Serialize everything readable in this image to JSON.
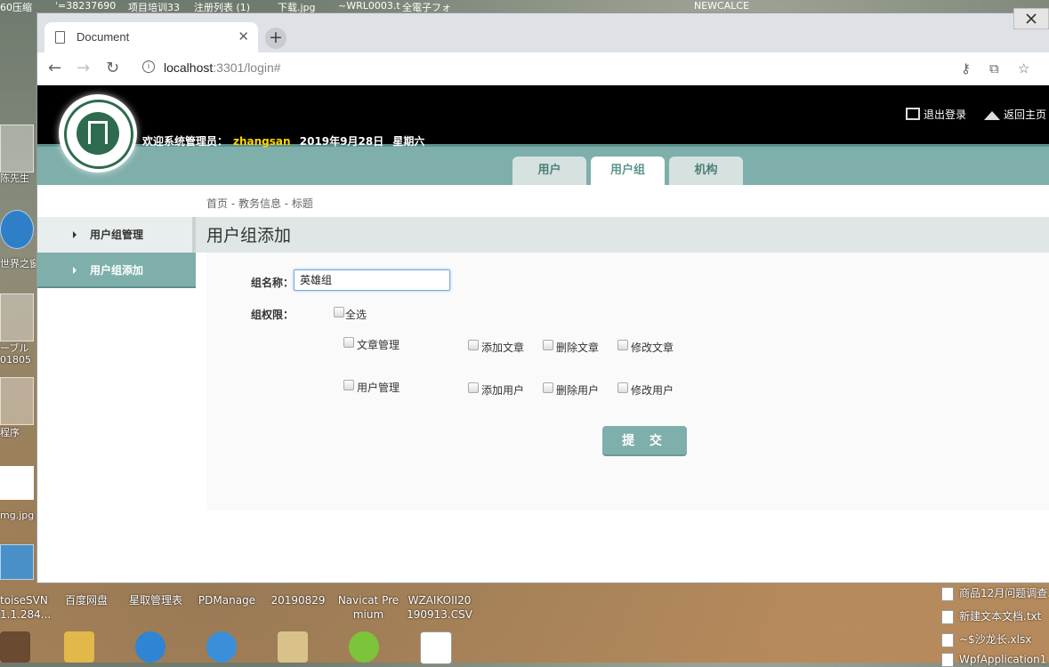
{
  "desktop": {
    "top_strip": [
      "60压缩",
      "ˈ=38237690",
      "项目培训33",
      "注册列表 (1)",
      "下载.jpg",
      "~WRL0003.t",
      "全電子フォ",
      "NEWCALCE"
    ],
    "left_labels": [
      "陈先生",
      "世界之窗",
      "ーブル",
      "01805",
      "程序",
      "mg.jpg"
    ],
    "bottom_labels": [
      "toiseSVN\n1.1.284...",
      "百度网盘",
      "星取管理表",
      "PDManage",
      "20190829",
      "Navicat Pre\nmium",
      "WZAIKOII20\n190913.CSV"
    ],
    "right_files": [
      "商品12月问题调查.",
      "新建文本文档.txt",
      "~$沙龙长.xlsx",
      "WpfApplication1"
    ]
  },
  "browser": {
    "tab_title": "Document",
    "url_host": "localhost",
    "url_rest": ":3301/login#"
  },
  "header": {
    "welcome_prefix": "欢迎系统管理员：",
    "username": "zhangsan",
    "date": "2019年9月28日",
    "weekday": "星期六",
    "logout": "退出登录",
    "home": "返回主页"
  },
  "top_tabs": [
    {
      "label": "用户",
      "active": false
    },
    {
      "label": "用户组",
      "active": true
    },
    {
      "label": "机构",
      "active": false
    }
  ],
  "breadcrumb": "首页 - 教务信息 - 标题",
  "sidebar": {
    "items": [
      {
        "label": "用户组管理",
        "active": false
      },
      {
        "label": "用户组添加",
        "active": true
      }
    ]
  },
  "panel": {
    "title": "用户组添加",
    "name_label": "组名称：",
    "name_value": "英雄组",
    "perm_label": "组权限：",
    "select_all": "全选",
    "groups": [
      {
        "label": "文章管理",
        "perms": [
          "添加文章",
          "删除文章",
          "修改文章"
        ]
      },
      {
        "label": "用户管理",
        "perms": [
          "添加用户",
          "删除用户",
          "修改用户"
        ]
      }
    ],
    "submit": "提 交"
  },
  "colors": {
    "accent": "#7fafaa",
    "header_bg": "#000000",
    "username": "#ffd700"
  }
}
